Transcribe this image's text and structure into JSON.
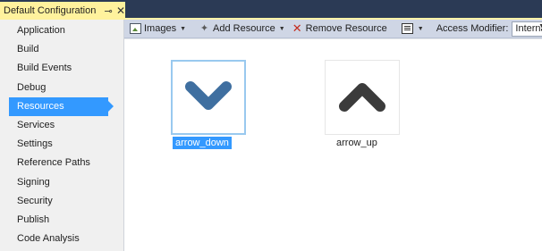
{
  "tab": {
    "title": "Default Configuration",
    "pin_glyph": "⊸",
    "close_glyph": "✕"
  },
  "sidebar": {
    "items": [
      {
        "label": "Application"
      },
      {
        "label": "Build"
      },
      {
        "label": "Build Events"
      },
      {
        "label": "Debug"
      },
      {
        "label": "Resources",
        "active": true
      },
      {
        "label": "Services"
      },
      {
        "label": "Settings"
      },
      {
        "label": "Reference Paths"
      },
      {
        "label": "Signing"
      },
      {
        "label": "Security"
      },
      {
        "label": "Publish"
      },
      {
        "label": "Code Analysis"
      }
    ]
  },
  "toolbar": {
    "images_label": "Images",
    "add_resource_label": "Add Resource",
    "remove_resource_label": "Remove Resource",
    "access_modifier_label": "Access Modifier:",
    "access_modifier_value": "Internal",
    "dropdown_glyph": "▼"
  },
  "resources": [
    {
      "name": "arrow_down",
      "icon": "chevron-down",
      "color": "#3f6fa0",
      "selected": true
    },
    {
      "name": "arrow_up",
      "icon": "chevron-up",
      "color": "#3b3b3b",
      "selected": false
    }
  ],
  "colors": {
    "accent": "#3399ff",
    "tab_active": "#fff29d",
    "toolbar": "#cfd6e5"
  }
}
